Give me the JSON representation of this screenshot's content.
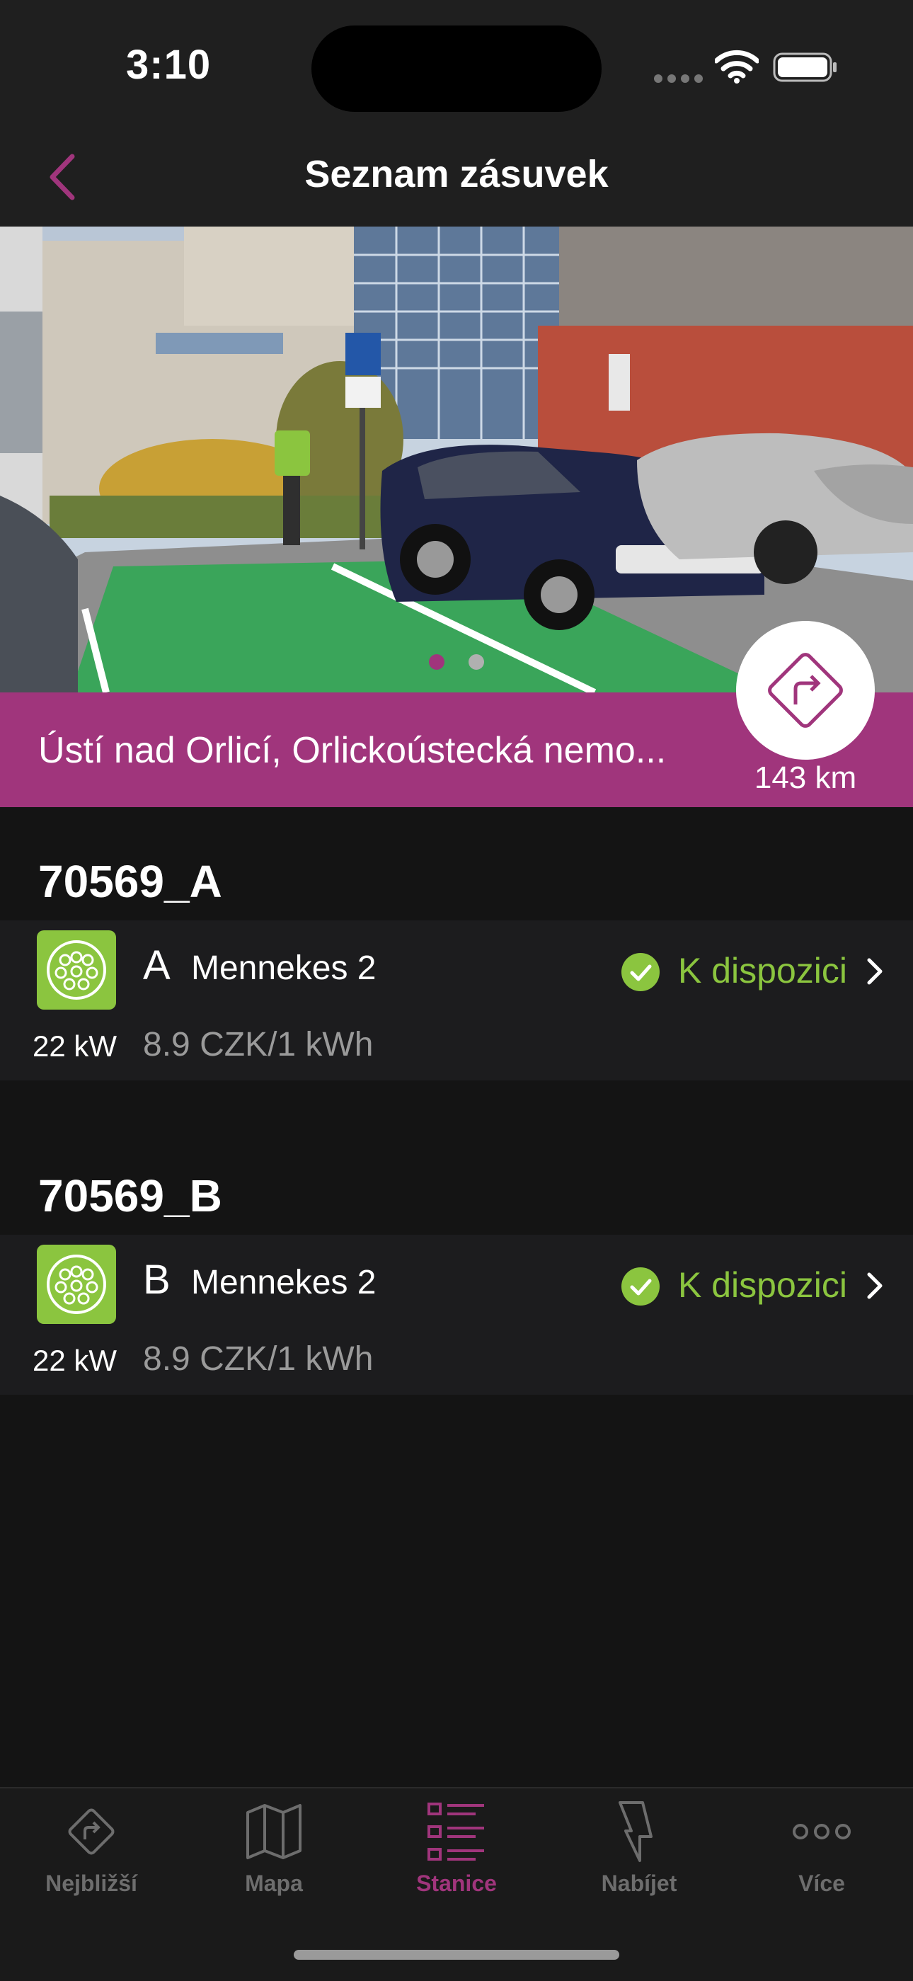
{
  "status_bar": {
    "time": "3:10"
  },
  "nav": {
    "title": "Seznam zásuvek"
  },
  "station": {
    "name": "Ústí nad Orlicí, Orlickoústecká nemo...",
    "distance": "143 km"
  },
  "groups": [
    {
      "title": "70569_A",
      "connector": {
        "letter": "A",
        "type": "Mennekes 2",
        "status": "K dispozici",
        "power": "22 kW",
        "price": "8.9 CZK/1 kWh"
      }
    },
    {
      "title": "70569_B",
      "connector": {
        "letter": "B",
        "type": "Mennekes 2",
        "status": "K dispozici",
        "power": "22 kW",
        "price": "8.9 CZK/1 kWh"
      }
    }
  ],
  "tabs": [
    {
      "label": "Nejbližší",
      "icon": "navigation-diamond-icon"
    },
    {
      "label": "Mapa",
      "icon": "map-icon"
    },
    {
      "label": "Stanice",
      "icon": "list-icon",
      "active": true
    },
    {
      "label": "Nabíjet",
      "icon": "lightning-icon"
    },
    {
      "label": "Více",
      "icon": "more-dots-icon"
    }
  ],
  "colors": {
    "accent": "#a0357c",
    "available": "#8bc53f",
    "background": "#141414"
  }
}
